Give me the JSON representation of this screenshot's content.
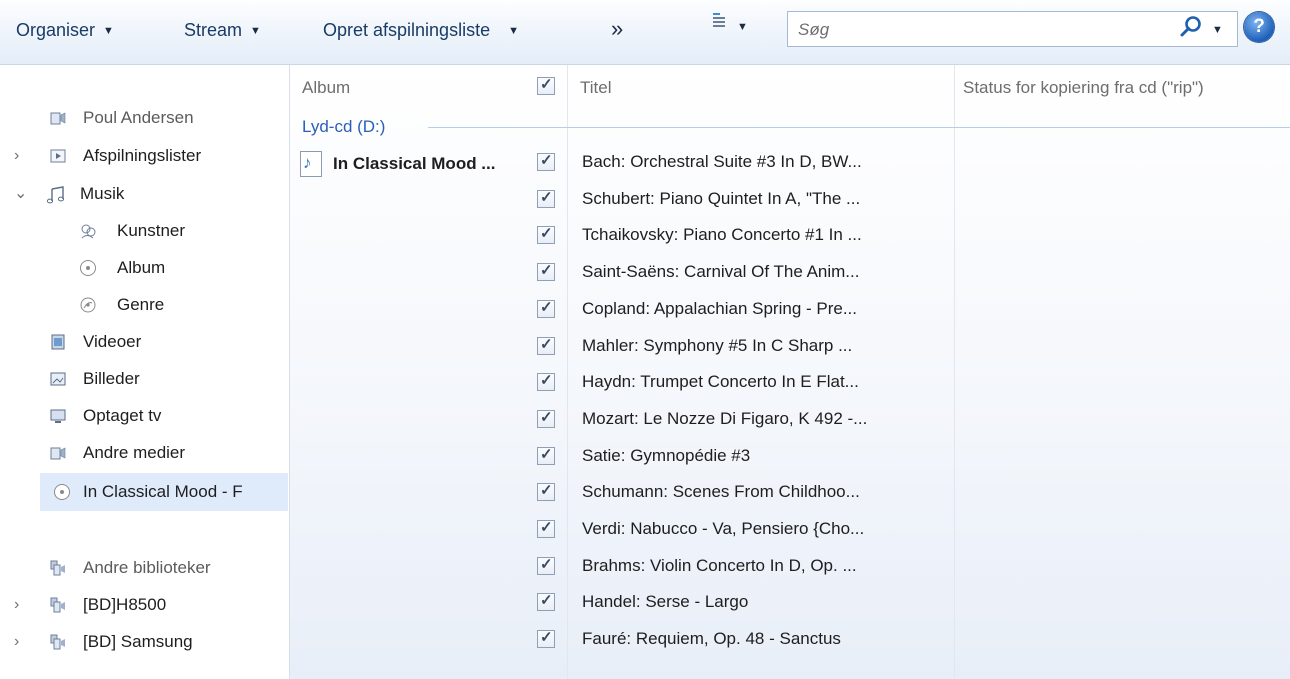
{
  "toolbar": {
    "organise_label": "Organiser",
    "stream_label": "Stream",
    "create_playlist_label": "Opret afspilningsliste",
    "more_label": "»",
    "search_placeholder": "Søg",
    "help_label": "?"
  },
  "nav": {
    "items": [
      {
        "label": "Poul Andersen",
        "icon": "media-library-icon"
      },
      {
        "label": "Afspilningslister",
        "icon": "playlist-icon"
      },
      {
        "label": "Musik",
        "icon": "music-note-icon"
      },
      {
        "label": "Kunstner",
        "icon": "artist-icon"
      },
      {
        "label": "Album",
        "icon": "album-disc-icon"
      },
      {
        "label": "Genre",
        "icon": "genre-icon"
      },
      {
        "label": "Videoer",
        "icon": "video-icon"
      },
      {
        "label": "Billeder",
        "icon": "pictures-icon"
      },
      {
        "label": "Optaget tv",
        "icon": "recorded-tv-icon"
      },
      {
        "label": "Andre medier",
        "icon": "other-media-icon"
      },
      {
        "label": "In Classical Mood - F",
        "icon": "cd-disc-icon"
      },
      {
        "label": "Andre biblioteker",
        "icon": "other-libraries-icon"
      },
      {
        "label": "[BD]H8500",
        "icon": "library-device-icon"
      },
      {
        "label": "[BD] Samsung",
        "icon": "library-device-icon"
      }
    ]
  },
  "columns": {
    "album": "Album",
    "title": "Titel",
    "rip_status": "Status for kopiering fra cd (\"rip\")"
  },
  "group": {
    "header": "Lyd-cd (D:)",
    "album_name": "In Classical Mood ..."
  },
  "tracks": [
    "Bach: Orchestral Suite #3 In D, BW...",
    "Schubert: Piano Quintet In A, \"The ...",
    "Tchaikovsky: Piano Concerto #1 In ...",
    "Saint-Saëns: Carnival Of The Anim...",
    "Copland: Appalachian Spring - Pre...",
    "Mahler: Symphony #5 In C Sharp ...",
    "Haydn: Trumpet Concerto In E Flat...",
    "Mozart: Le Nozze Di Figaro, K 492 -...",
    "Satie: Gymnopédie #3",
    "Schumann: Scenes From Childhoo...",
    "Verdi: Nabucco - Va, Pensiero {Cho...",
    "Brahms: Violin Concerto In D, Op. ...",
    "Handel: Serse - Largo",
    "Fauré: Requiem, Op. 48 - Sanctus"
  ]
}
